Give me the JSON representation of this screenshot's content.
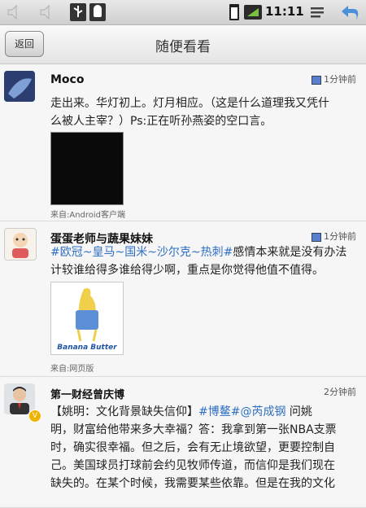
{
  "status": {
    "time": "11:11"
  },
  "header": {
    "back_label": "返回",
    "title": "随便看看"
  },
  "posts": [
    {
      "user": "Moco",
      "time_ago": "1分钟前",
      "text_line1": "走出来。华灯初上。灯月相应。（这是什么道理我又凭什",
      "text_line2": "么被人主宰？）Ps:正在听孙燕姿的空口言。",
      "source": "来自:Android客户端"
    },
    {
      "user": "蛋蛋老师与蔬果妹妹",
      "time_ago": "1分钟前",
      "hashtags": "#欧冠~皇马~国米~沙尔克~热刺#",
      "text_line1_rest": "感情本来就是没有办法",
      "text_line2": "计较谁给得多谁给得少啊，重点是你觉得他值不值得。",
      "image_caption": "Banana Butter",
      "source": "来自:网页版"
    },
    {
      "user": "第一财经曾庆博",
      "time_ago": "2分钟前",
      "line1_a": "【姚明：文化背景缺失信仰】",
      "line1_tag": "#博鳌#@芮成钢",
      "line1_b": " 问姚",
      "line2": "明，财富给他带来多大幸福？答：我拿到第一张NBA支票",
      "line3": "时，确实很幸福。但之后，会有无止境欲望，更要控制自",
      "line4": "己。美国球员打球前会约见牧师传道，而信仰是我们现在",
      "line5": "缺失的。在某个时候，我需要某些依靠。但是在我的文化"
    }
  ]
}
